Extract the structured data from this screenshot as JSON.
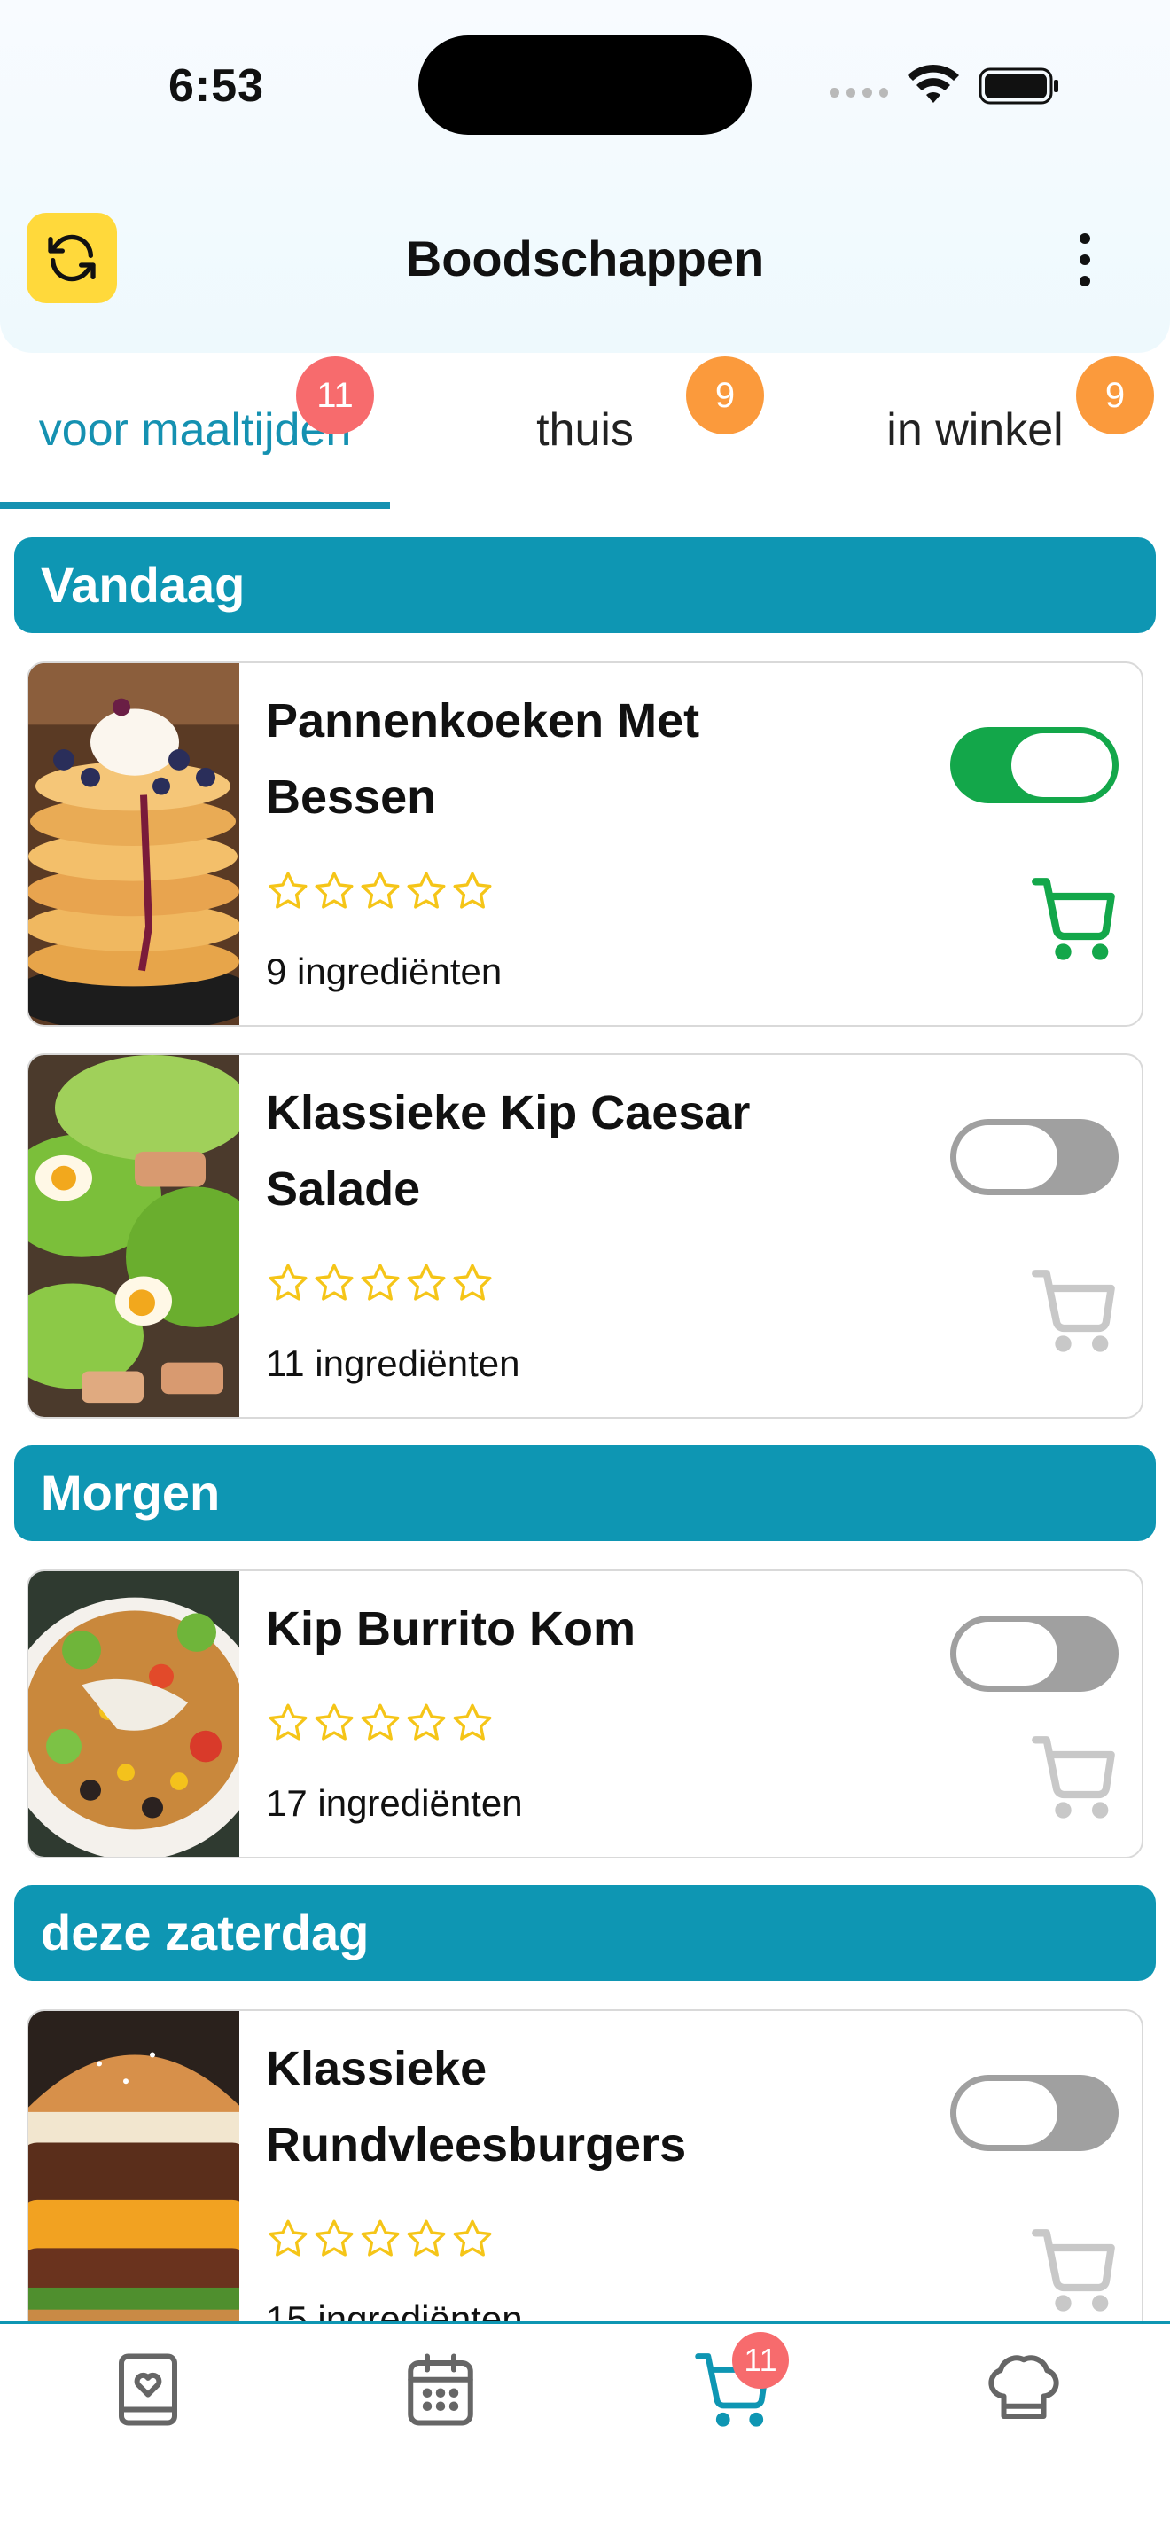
{
  "status_bar": {
    "time": "6:53"
  },
  "app_bar": {
    "title": "Boodschappen",
    "refresh_icon": "refresh-icon",
    "more_icon": "more-vertical-icon"
  },
  "tabs": [
    {
      "label": "voor maaltijden",
      "badge": "11",
      "badge_color": "#f76b6d",
      "active": true
    },
    {
      "label": "thuis",
      "badge": "9",
      "badge_color": "#fb9a3c",
      "active": false
    },
    {
      "label": "in winkel",
      "badge": "9",
      "badge_color": "#fb9a3c",
      "active": false
    }
  ],
  "sections": [
    {
      "title": "Vandaag",
      "recipes": [
        {
          "name_line1": "Pannenkoeken Met",
          "name_line2": "Bessen",
          "rating": 0,
          "ingredients": "9 ingrediënten",
          "toggled": true
        },
        {
          "name_line1": "Klassieke Kip Caesar",
          "name_line2": "Salade",
          "rating": 0,
          "ingredients": "11 ingrediënten",
          "toggled": false
        }
      ]
    },
    {
      "title": "Morgen",
      "recipes": [
        {
          "name_line1": "Kip Burrito Kom",
          "rating": 0,
          "ingredients": "17 ingrediënten",
          "toggled": false
        }
      ]
    },
    {
      "title": "deze zaterdag",
      "recipes": [
        {
          "name_line1": "Klassieke",
          "name_line2": "Rundvleesburgers",
          "rating": 0,
          "ingredients": "15 ingrediënten",
          "toggled": false
        }
      ]
    }
  ],
  "bottom_nav": {
    "items": [
      "recipe-book-icon",
      "calendar-icon",
      "cart-icon",
      "chef-hat-icon"
    ],
    "active": "cart-icon",
    "cart_badge": "11"
  },
  "colors": {
    "accent": "#0e96b3",
    "toggle_on": "#13a74a",
    "toggle_off": "#a0a0a0",
    "star": "#f5c518",
    "refresh_bg": "#ffd93b"
  }
}
